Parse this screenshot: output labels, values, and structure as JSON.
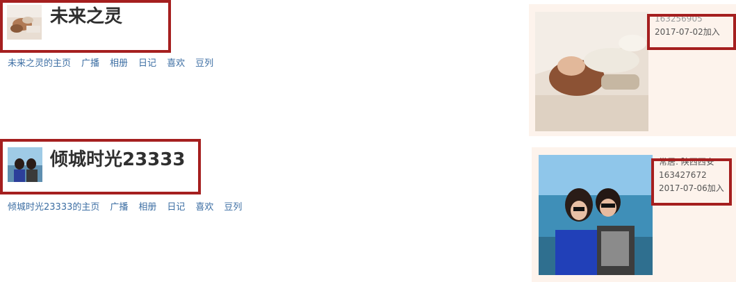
{
  "profiles": [
    {
      "name": "未来之灵",
      "nav": [
        "未来之灵的主页",
        "广播",
        "相册",
        "日记",
        "喜欢",
        "豆列"
      ],
      "info": [
        "163256905",
        "2017-07-02加入"
      ]
    },
    {
      "name": "倾城时光23333",
      "nav": [
        "倾城时光23333的主页",
        "广播",
        "相册",
        "日记",
        "喜欢",
        "豆列"
      ],
      "info": [
        "常居: 陕西西安",
        "163427672",
        "2017-07-06加入"
      ]
    }
  ],
  "colors": {
    "highlight": "#a51f1f",
    "link": "#3c6ea3",
    "panel_bg": "#fdf3ec"
  }
}
